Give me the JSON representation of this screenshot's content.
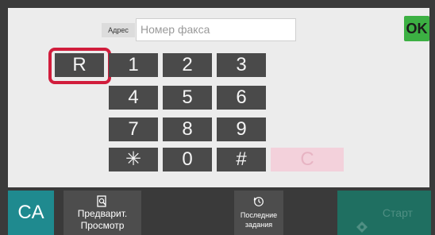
{
  "address": {
    "label": "Адрес",
    "placeholder": "Номер факса"
  },
  "ok_button": "OK",
  "keypad": {
    "r_key": "R",
    "keys": [
      "1",
      "2",
      "3",
      "4",
      "5",
      "6",
      "7",
      "8",
      "9",
      "✳",
      "0",
      "#"
    ],
    "clear_key": "C"
  },
  "bottom": {
    "ca_label": "CA",
    "preview_label_line1": "Предварит.",
    "preview_label_line2": "Просмотр",
    "history_label_line1": "Последние",
    "history_label_line2": "задания",
    "start_label": "Старт",
    "icons": {
      "preview": "preview-icon",
      "history": "history-icon",
      "start": "start-diamond-icon"
    }
  },
  "colors": {
    "ok": "#3cb043",
    "ca": "#1f8a8f",
    "start": "#1f6f61",
    "highlight": "#d11d3c"
  }
}
